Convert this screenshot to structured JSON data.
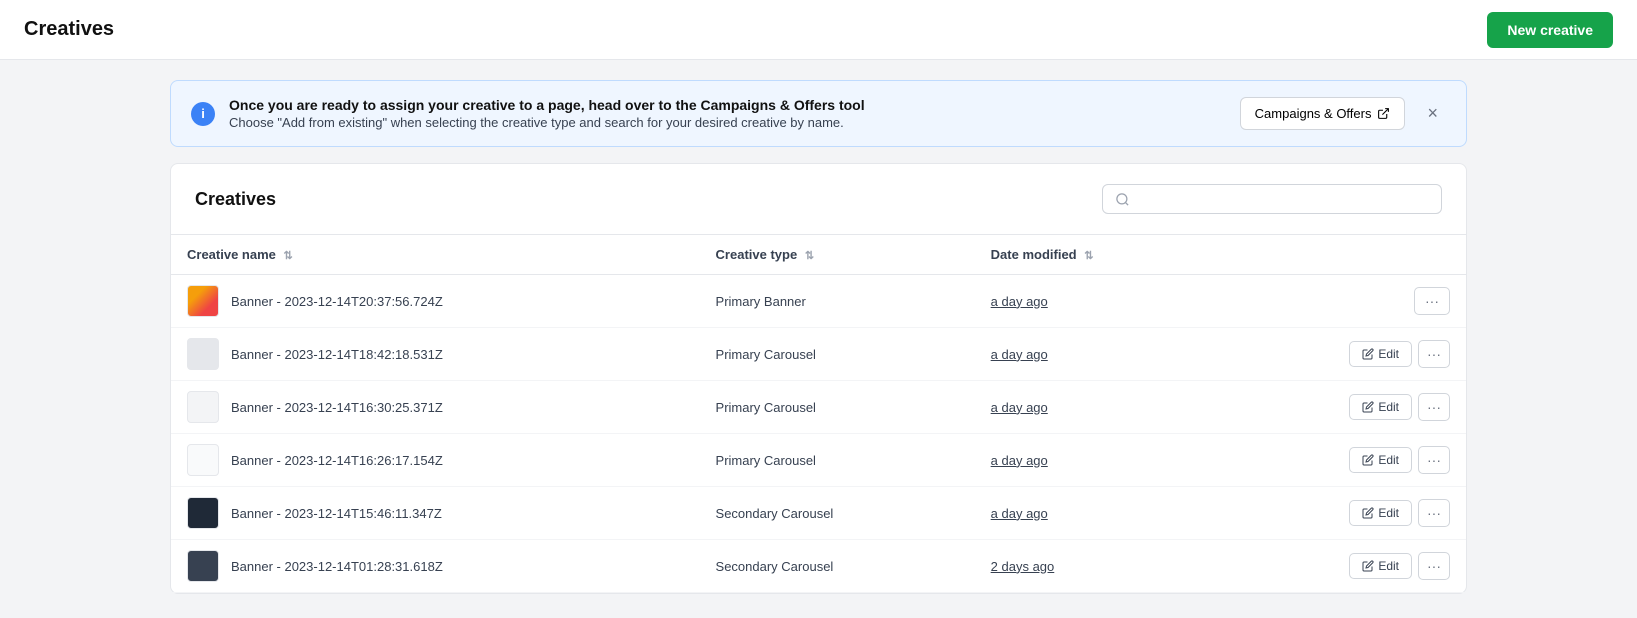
{
  "topbar": {
    "title": "Creatives",
    "new_creative_label": "New creative"
  },
  "info_banner": {
    "icon_label": "i",
    "bold_text": "Once you are ready to assign your creative to a page, head over to the Campaigns & Offers tool",
    "sub_text": "Choose \"Add from existing\" when selecting the creative type and search for your desired creative by name.",
    "campaigns_btn_label": "Campaigns & Offers",
    "close_label": "×"
  },
  "main": {
    "title": "Creatives",
    "search_placeholder": "",
    "columns": {
      "creative_name": "Creative name",
      "creative_type": "Creative type",
      "date_modified": "Date modified"
    },
    "rows": [
      {
        "id": 1,
        "thumb_class": "thumb-img-1",
        "name": "Banner - 2023-12-14T20:37:56.724Z",
        "type": "Primary Banner",
        "date": "a day ago",
        "has_edit": false
      },
      {
        "id": 2,
        "thumb_class": "thumb-img-2",
        "name": "Banner - 2023-12-14T18:42:18.531Z",
        "type": "Primary Carousel",
        "date": "a day ago",
        "has_edit": true
      },
      {
        "id": 3,
        "thumb_class": "thumb-img-3",
        "name": "Banner - 2023-12-14T16:30:25.371Z",
        "type": "Primary Carousel",
        "date": "a day ago",
        "has_edit": true
      },
      {
        "id": 4,
        "thumb_class": "thumb-img-4",
        "name": "Banner - 2023-12-14T16:26:17.154Z",
        "type": "Primary Carousel",
        "date": "a day ago",
        "has_edit": true
      },
      {
        "id": 5,
        "thumb_class": "thumb-img-5",
        "name": "Banner - 2023-12-14T15:46:11.347Z",
        "type": "Secondary Carousel",
        "date": "a day ago",
        "has_edit": true
      },
      {
        "id": 6,
        "thumb_class": "thumb-img-6",
        "name": "Banner - 2023-12-14T01:28:31.618Z",
        "type": "Secondary Carousel",
        "date": "2 days ago",
        "has_edit": true
      }
    ],
    "edit_label": "Edit"
  }
}
